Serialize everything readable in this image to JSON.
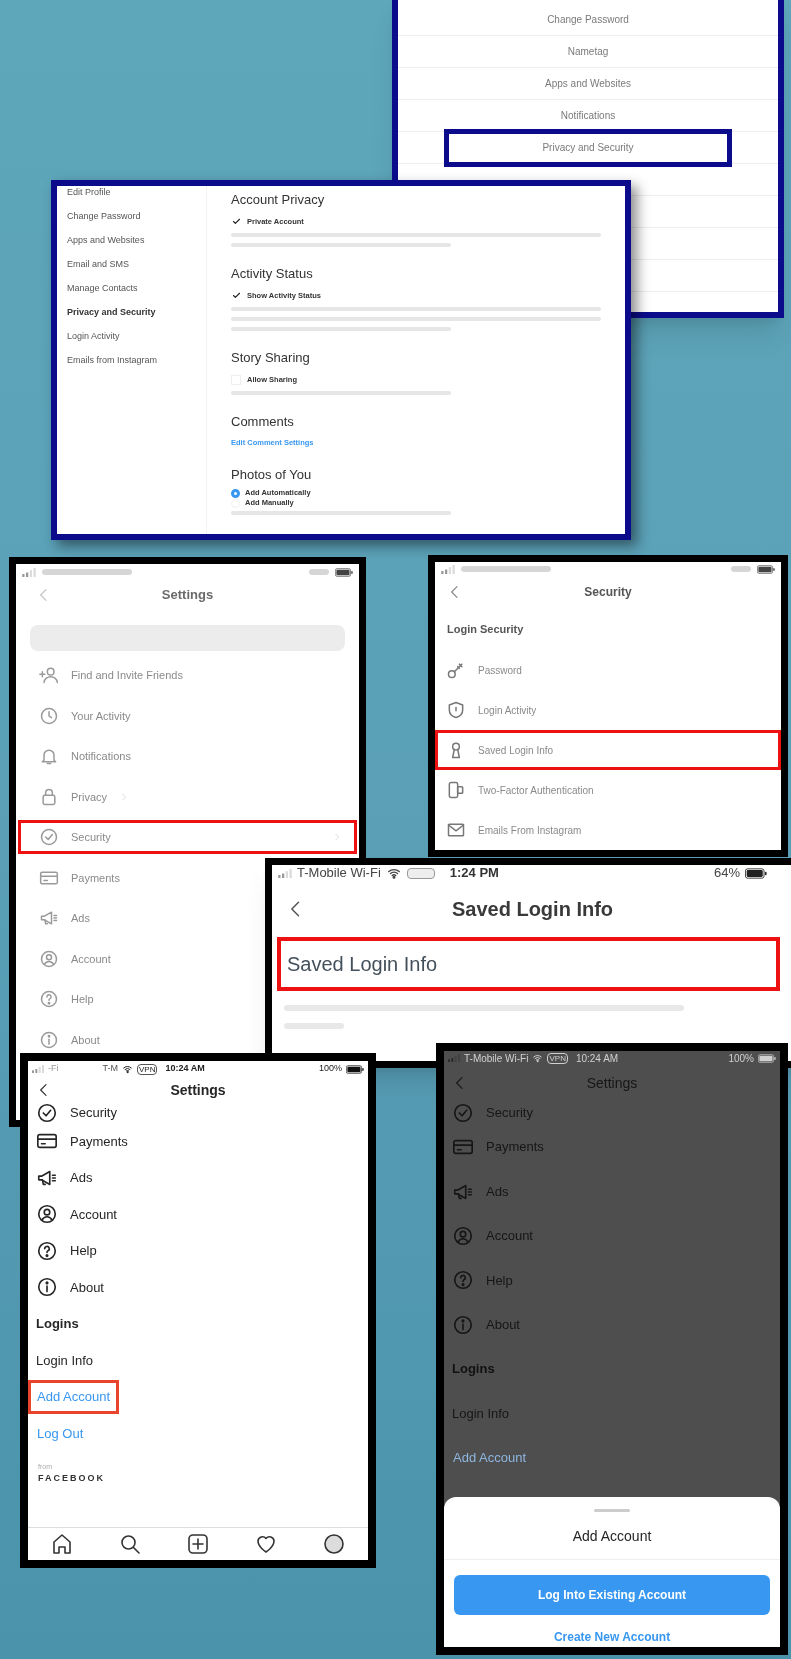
{
  "menu_panel": {
    "items": [
      {
        "label": "Change Password",
        "highlighted": false
      },
      {
        "label": "Nametag",
        "highlighted": false
      },
      {
        "label": "Apps and Websites",
        "highlighted": false
      },
      {
        "label": "Notifications",
        "highlighted": false
      },
      {
        "label": "Privacy and Security",
        "highlighted": true
      }
    ]
  },
  "web_settings": {
    "sidebar": [
      {
        "label": "Edit Profile",
        "selected": false
      },
      {
        "label": "Change Password",
        "selected": false
      },
      {
        "label": "Apps and Websites",
        "selected": false
      },
      {
        "label": "Email and SMS",
        "selected": false
      },
      {
        "label": "Manage Contacts",
        "selected": false
      },
      {
        "label": "Privacy and Security",
        "selected": true
      },
      {
        "label": "Login Activity",
        "selected": false
      },
      {
        "label": "Emails from Instagram",
        "selected": false
      }
    ],
    "sections": [
      {
        "title": "Account Privacy",
        "options": [
          {
            "kind": "checkbox",
            "label": "Private Account",
            "checked": true
          }
        ]
      },
      {
        "title": "Activity Status",
        "options": [
          {
            "kind": "checkbox",
            "label": "Show Activity Status",
            "checked": true
          }
        ]
      },
      {
        "title": "Story Sharing",
        "options": [
          {
            "kind": "checkbox",
            "label": "Allow Sharing",
            "checked": false
          }
        ]
      },
      {
        "title": "Comments",
        "options": [
          {
            "kind": "link",
            "label": "Edit Comment Settings"
          }
        ]
      },
      {
        "title": "Photos of You",
        "options": [
          {
            "kind": "radio",
            "label": "Add Automatically",
            "selected": true
          },
          {
            "kind": "radio",
            "label": "Add Manually",
            "selected": false
          }
        ]
      }
    ]
  },
  "settings_screen": {
    "title": "Settings",
    "items": [
      {
        "label": "Find and Invite Friends",
        "highlighted": false
      },
      {
        "label": "Your Activity",
        "highlighted": false
      },
      {
        "label": "Notifications",
        "highlighted": false
      },
      {
        "label": "Privacy",
        "highlighted": false
      },
      {
        "label": "Security",
        "highlighted": true
      },
      {
        "label": "Payments",
        "highlighted": false
      },
      {
        "label": "Ads",
        "highlighted": false
      },
      {
        "label": "Account",
        "highlighted": false
      },
      {
        "label": "Help",
        "highlighted": false
      },
      {
        "label": "About",
        "highlighted": false
      }
    ]
  },
  "security_screen": {
    "title": "Security",
    "section": "Login Security",
    "items": [
      {
        "label": "Password",
        "highlighted": false
      },
      {
        "label": "Login Activity",
        "highlighted": false
      },
      {
        "label": "Saved Login Info",
        "highlighted": true
      },
      {
        "label": "Two-Factor Authentication",
        "highlighted": false
      },
      {
        "label": "Emails From Instagram",
        "highlighted": false
      }
    ]
  },
  "saved_login_screen": {
    "status_bar": {
      "carrier": "T-Mobile Wi-Fi",
      "time": "1:24 PM",
      "battery": "64%"
    },
    "title": "Saved Login Info",
    "item": {
      "label": "Saved Login Info",
      "highlighted": true
    }
  },
  "logins_screen": {
    "status_bar": {
      "signal_text": "-Fi",
      "carrier": "T-M",
      "vpn": "VPN",
      "time": "10:24 AM",
      "battery": "100%"
    },
    "title": "Settings",
    "items": [
      {
        "kind": "icon_item",
        "label": "Security"
      },
      {
        "kind": "icon_item",
        "label": "Payments"
      },
      {
        "kind": "icon_item",
        "label": "Ads"
      },
      {
        "kind": "icon_item",
        "label": "Account"
      },
      {
        "kind": "icon_item",
        "label": "Help"
      },
      {
        "kind": "icon_item",
        "label": "About"
      },
      {
        "kind": "header",
        "label": "Logins"
      },
      {
        "kind": "plain",
        "label": "Login Info"
      },
      {
        "kind": "link",
        "label": "Add Account",
        "highlighted": true
      },
      {
        "kind": "link",
        "label": "Log Out",
        "highlighted": false
      }
    ],
    "footer": {
      "from": "from",
      "brand": "FACEBOOK"
    }
  },
  "add_account_screen": {
    "status_bar": {
      "carrier": "T-Mobile Wi-Fi",
      "vpn": "VPN",
      "time": "10:24 AM",
      "battery": "100%"
    },
    "title": "Settings",
    "items": [
      {
        "kind": "icon_item",
        "label": "Security"
      },
      {
        "kind": "icon_item",
        "label": "Payments"
      },
      {
        "kind": "icon_item",
        "label": "Ads"
      },
      {
        "kind": "icon_item",
        "label": "Account"
      },
      {
        "kind": "icon_item",
        "label": "Help"
      },
      {
        "kind": "icon_item",
        "label": "About"
      },
      {
        "kind": "header",
        "label": "Logins"
      },
      {
        "kind": "plain",
        "label": "Login Info"
      },
      {
        "kind": "link",
        "label": "Add Account",
        "highlighted": false
      }
    ],
    "sheet": {
      "title": "Add Account",
      "primary_button": "Log Into Existing Account",
      "secondary_button": "Create New Account"
    }
  }
}
